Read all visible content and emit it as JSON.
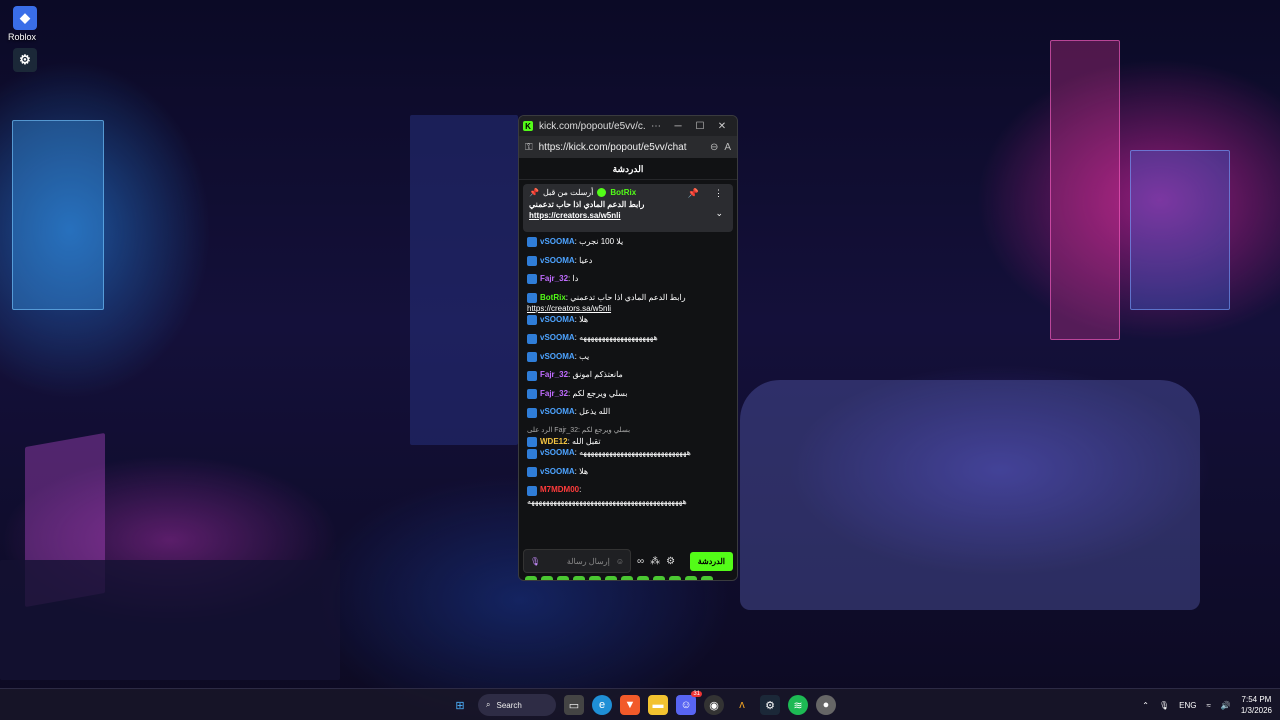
{
  "desktop": {
    "icons": [
      {
        "label": "Roblox",
        "icon": "roblox-icon",
        "color": "#3a6ee8"
      },
      {
        "label": "",
        "icon": "steam-icon",
        "color": "#1b2838"
      }
    ]
  },
  "browser": {
    "title": "kick.com/popout/e5vv/c...",
    "url": "https://kick.com/popout/e5vv/chat"
  },
  "chat": {
    "header": "الدردشة",
    "pinned": {
      "by_label": "أرسلت من قبل",
      "user": "BotRix",
      "message": "رابط الدعم المادي اذا حاب تدعمني",
      "link": "https://creators.sa/w5nli"
    },
    "messages": [
      {
        "user": "vSOOMA",
        "color": "#4da3ff",
        "text": "يلا 100 نجرب"
      },
      {
        "user": "vSOOMA",
        "color": "#4da3ff",
        "text": "دعيا"
      },
      {
        "user": "Fajr_32",
        "color": "#c06cff",
        "text": "دا"
      },
      {
        "user": "BotRix",
        "color": "#53fc18",
        "text": "رابط الدعم المادي اذا حاب تدعمني",
        "link": "https://creators.sa/w5nli"
      },
      {
        "user": "vSOOMA",
        "color": "#4da3ff",
        "text": "هلا"
      },
      {
        "user": "vSOOMA",
        "color": "#4da3ff",
        "text": "ههههههههههههههههههههه"
      },
      {
        "user": "vSOOMA",
        "color": "#4da3ff",
        "text": "يب"
      },
      {
        "user": "Fajr_32",
        "color": "#c06cff",
        "text": "مانعتذكم امونق"
      },
      {
        "user": "Fajr_32",
        "color": "#c06cff",
        "text": "بسلي ويرجع لكم"
      },
      {
        "user": "vSOOMA",
        "color": "#4da3ff",
        "text": "الله يذعل"
      },
      {
        "user": "WDE12",
        "color": "#f5c542",
        "text": "تقبل الله",
        "reply": "الرد على Fajr_32: بسلي ويرجع لكم"
      },
      {
        "user": "vSOOMA",
        "color": "#4da3ff",
        "text": "هههههههههههههههههههههههههههههه"
      },
      {
        "user": "vSOOMA",
        "color": "#4da3ff",
        "text": "هلا"
      },
      {
        "user": "M7MDM00",
        "color": "#ff3b3b",
        "text": "ههههههههههههههههههههههههههههههههههههههههههه"
      }
    ],
    "input": {
      "placeholder": "إرسال رسالة",
      "send_label": "الدردشة"
    }
  },
  "taskbar": {
    "search_label": "Search",
    "language": "ENG",
    "time": "7:54 PM",
    "date": "1/3/2026",
    "discord_badge": "31"
  }
}
